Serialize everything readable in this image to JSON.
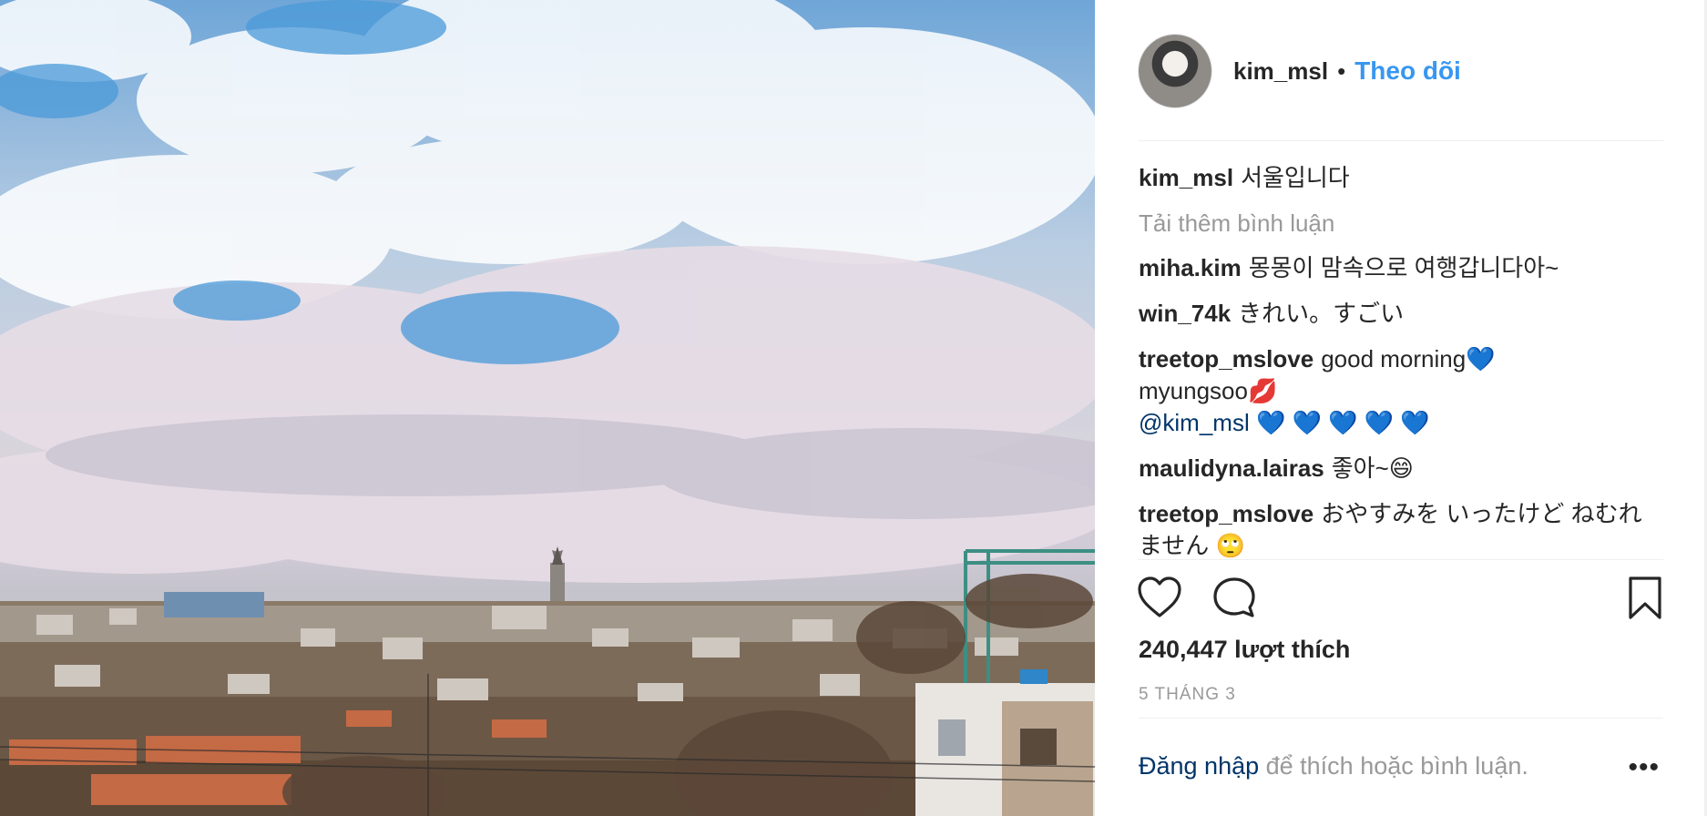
{
  "post": {
    "username": "kim_msl",
    "follow_label": "Theo dõi",
    "separator": "•"
  },
  "caption": {
    "username": "kim_msl",
    "text": "서울입니다"
  },
  "load_more": "Tải thêm bình luận",
  "comments": [
    {
      "username": "miha.kim",
      "text": "몽몽이 맘속으로 여행갑니다아~"
    },
    {
      "username": "win_74k",
      "text": "きれい。すごい"
    },
    {
      "username": "treetop_mslove",
      "text": "good morning💙",
      "line2": "myungsoo💋",
      "mention": "@kim_msl",
      "line3": "💙 💙 💙 💙 💙"
    },
    {
      "username": "maulidyna.lairas",
      "text": "좋아~😄"
    },
    {
      "username": "treetop_mslove",
      "text": "おやすみを いったけど ねむれません 🙄"
    }
  ],
  "likes": "240,447 lượt thích",
  "date": "5 THÁNG 3",
  "login": {
    "link": "Đăng nhập",
    "text": " để thích hoặc bình luận."
  },
  "more_label": "•••",
  "icons": {
    "like": "heart-icon",
    "comment": "comment-icon",
    "save": "bookmark-icon",
    "more": "more-options-icon"
  },
  "colors": {
    "accent": "#3897f0",
    "link_dark": "#003569",
    "muted": "#999999",
    "text": "#262626"
  }
}
